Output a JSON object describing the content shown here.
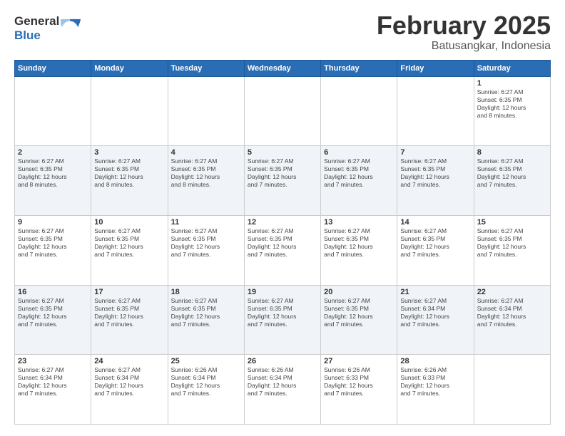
{
  "logo": {
    "general": "General",
    "blue": "Blue"
  },
  "calendar": {
    "title": "February 2025",
    "subtitle": "Batusangkar, Indonesia",
    "days_of_week": [
      "Sunday",
      "Monday",
      "Tuesday",
      "Wednesday",
      "Thursday",
      "Friday",
      "Saturday"
    ],
    "weeks": [
      {
        "shaded": false,
        "days": [
          {
            "num": "",
            "info": ""
          },
          {
            "num": "",
            "info": ""
          },
          {
            "num": "",
            "info": ""
          },
          {
            "num": "",
            "info": ""
          },
          {
            "num": "",
            "info": ""
          },
          {
            "num": "",
            "info": ""
          },
          {
            "num": "1",
            "info": "Sunrise: 6:27 AM\nSunset: 6:35 PM\nDaylight: 12 hours\nand 8 minutes."
          }
        ]
      },
      {
        "shaded": true,
        "days": [
          {
            "num": "2",
            "info": "Sunrise: 6:27 AM\nSunset: 6:35 PM\nDaylight: 12 hours\nand 8 minutes."
          },
          {
            "num": "3",
            "info": "Sunrise: 6:27 AM\nSunset: 6:35 PM\nDaylight: 12 hours\nand 8 minutes."
          },
          {
            "num": "4",
            "info": "Sunrise: 6:27 AM\nSunset: 6:35 PM\nDaylight: 12 hours\nand 8 minutes."
          },
          {
            "num": "5",
            "info": "Sunrise: 6:27 AM\nSunset: 6:35 PM\nDaylight: 12 hours\nand 7 minutes."
          },
          {
            "num": "6",
            "info": "Sunrise: 6:27 AM\nSunset: 6:35 PM\nDaylight: 12 hours\nand 7 minutes."
          },
          {
            "num": "7",
            "info": "Sunrise: 6:27 AM\nSunset: 6:35 PM\nDaylight: 12 hours\nand 7 minutes."
          },
          {
            "num": "8",
            "info": "Sunrise: 6:27 AM\nSunset: 6:35 PM\nDaylight: 12 hours\nand 7 minutes."
          }
        ]
      },
      {
        "shaded": false,
        "days": [
          {
            "num": "9",
            "info": "Sunrise: 6:27 AM\nSunset: 6:35 PM\nDaylight: 12 hours\nand 7 minutes."
          },
          {
            "num": "10",
            "info": "Sunrise: 6:27 AM\nSunset: 6:35 PM\nDaylight: 12 hours\nand 7 minutes."
          },
          {
            "num": "11",
            "info": "Sunrise: 6:27 AM\nSunset: 6:35 PM\nDaylight: 12 hours\nand 7 minutes."
          },
          {
            "num": "12",
            "info": "Sunrise: 6:27 AM\nSunset: 6:35 PM\nDaylight: 12 hours\nand 7 minutes."
          },
          {
            "num": "13",
            "info": "Sunrise: 6:27 AM\nSunset: 6:35 PM\nDaylight: 12 hours\nand 7 minutes."
          },
          {
            "num": "14",
            "info": "Sunrise: 6:27 AM\nSunset: 6:35 PM\nDaylight: 12 hours\nand 7 minutes."
          },
          {
            "num": "15",
            "info": "Sunrise: 6:27 AM\nSunset: 6:35 PM\nDaylight: 12 hours\nand 7 minutes."
          }
        ]
      },
      {
        "shaded": true,
        "days": [
          {
            "num": "16",
            "info": "Sunrise: 6:27 AM\nSunset: 6:35 PM\nDaylight: 12 hours\nand 7 minutes."
          },
          {
            "num": "17",
            "info": "Sunrise: 6:27 AM\nSunset: 6:35 PM\nDaylight: 12 hours\nand 7 minutes."
          },
          {
            "num": "18",
            "info": "Sunrise: 6:27 AM\nSunset: 6:35 PM\nDaylight: 12 hours\nand 7 minutes."
          },
          {
            "num": "19",
            "info": "Sunrise: 6:27 AM\nSunset: 6:35 PM\nDaylight: 12 hours\nand 7 minutes."
          },
          {
            "num": "20",
            "info": "Sunrise: 6:27 AM\nSunset: 6:35 PM\nDaylight: 12 hours\nand 7 minutes."
          },
          {
            "num": "21",
            "info": "Sunrise: 6:27 AM\nSunset: 6:34 PM\nDaylight: 12 hours\nand 7 minutes."
          },
          {
            "num": "22",
            "info": "Sunrise: 6:27 AM\nSunset: 6:34 PM\nDaylight: 12 hours\nand 7 minutes."
          }
        ]
      },
      {
        "shaded": false,
        "days": [
          {
            "num": "23",
            "info": "Sunrise: 6:27 AM\nSunset: 6:34 PM\nDaylight: 12 hours\nand 7 minutes."
          },
          {
            "num": "24",
            "info": "Sunrise: 6:27 AM\nSunset: 6:34 PM\nDaylight: 12 hours\nand 7 minutes."
          },
          {
            "num": "25",
            "info": "Sunrise: 6:26 AM\nSunset: 6:34 PM\nDaylight: 12 hours\nand 7 minutes."
          },
          {
            "num": "26",
            "info": "Sunrise: 6:26 AM\nSunset: 6:34 PM\nDaylight: 12 hours\nand 7 minutes."
          },
          {
            "num": "27",
            "info": "Sunrise: 6:26 AM\nSunset: 6:33 PM\nDaylight: 12 hours\nand 7 minutes."
          },
          {
            "num": "28",
            "info": "Sunrise: 6:26 AM\nSunset: 6:33 PM\nDaylight: 12 hours\nand 7 minutes."
          },
          {
            "num": "",
            "info": ""
          }
        ]
      }
    ]
  }
}
